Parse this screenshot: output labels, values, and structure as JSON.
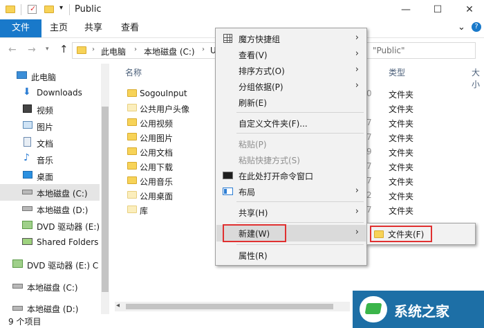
{
  "window": {
    "title": "Public",
    "minimize": "—",
    "maximize": "☐",
    "close": "✕"
  },
  "ribbon": {
    "tabs": [
      "文件",
      "主页",
      "共享",
      "查看"
    ],
    "expand": "⌄",
    "help": "?"
  },
  "address": {
    "crumbs": [
      "此电脑",
      "本地磁盘 (C:)",
      "U"
    ],
    "search_placeholder": "\"Public\""
  },
  "nav": {
    "items": [
      {
        "label": "此电脑",
        "icon": "computer-icon"
      },
      {
        "label": "Downloads",
        "icon": "download-arrow-icon"
      },
      {
        "label": "视频",
        "icon": "video-icon"
      },
      {
        "label": "图片",
        "icon": "picture-icon"
      },
      {
        "label": "文档",
        "icon": "document-icon"
      },
      {
        "label": "音乐",
        "icon": "music-icon"
      },
      {
        "label": "桌面",
        "icon": "desktop-icon"
      },
      {
        "label": "本地磁盘 (C:)",
        "icon": "drive-icon"
      },
      {
        "label": "本地磁盘 (D:)",
        "icon": "drive-icon"
      },
      {
        "label": "DVD 驱动器 (E:)",
        "icon": "dvd-icon"
      },
      {
        "label": "Shared Folders",
        "icon": "network-drive-icon"
      },
      {
        "label": "DVD 驱动器 (E:) C",
        "icon": "dvd-icon"
      },
      {
        "label": "本地磁盘 (C:)",
        "icon": "drive-icon"
      },
      {
        "label": "本地磁盘 (D:)",
        "icon": "drive-icon"
      }
    ]
  },
  "content": {
    "headers": {
      "name": "名称",
      "type": "类型",
      "size": "大小"
    },
    "files": [
      {
        "name": "SogouInput",
        "type": "文件夹",
        "date_frag": "0"
      },
      {
        "name": "公共用户头像",
        "type": "文件夹",
        "date_frag": ""
      },
      {
        "name": "公用视频",
        "type": "文件夹",
        "date_frag": "7"
      },
      {
        "name": "公用图片",
        "type": "文件夹",
        "date_frag": "7"
      },
      {
        "name": "公用文档",
        "type": "文件夹",
        "date_frag": "9"
      },
      {
        "name": "公用下载",
        "type": "文件夹",
        "date_frag": "7"
      },
      {
        "name": "公用音乐",
        "type": "文件夹",
        "date_frag": "7"
      },
      {
        "name": "公用桌面",
        "type": "文件夹",
        "date_frag": "2"
      },
      {
        "name": "库",
        "type": "文件夹",
        "date_frag": "7"
      }
    ]
  },
  "status": {
    "count": "9 个项目"
  },
  "context_menu": {
    "items": [
      {
        "label": "魔方快捷组",
        "arrow": "›",
        "icon": "grid-icon"
      },
      {
        "label": "查看(V)",
        "arrow": "›"
      },
      {
        "label": "排序方式(O)",
        "arrow": "›"
      },
      {
        "label": "分组依据(P)",
        "arrow": "›"
      },
      {
        "label": "刷新(E)"
      },
      {
        "label": "自定义文件夹(F)..."
      },
      {
        "label": "粘贴(P)",
        "disabled": true
      },
      {
        "label": "粘贴快捷方式(S)",
        "disabled": true
      },
      {
        "label": "在此处打开命令窗口",
        "icon": "cmd-icon"
      },
      {
        "label": "布局",
        "arrow": "›",
        "icon": "layout-icon"
      },
      {
        "label": "共享(H)",
        "arrow": "›"
      },
      {
        "label": "新建(W)",
        "arrow": "›"
      },
      {
        "label": "属性(R)"
      }
    ]
  },
  "submenu": {
    "items": [
      {
        "label": "文件夹(F)"
      }
    ]
  },
  "watermark": {
    "text": "系统之家"
  },
  "colors": {
    "accent": "#1979ca",
    "highlight_box": "#e03030"
  }
}
